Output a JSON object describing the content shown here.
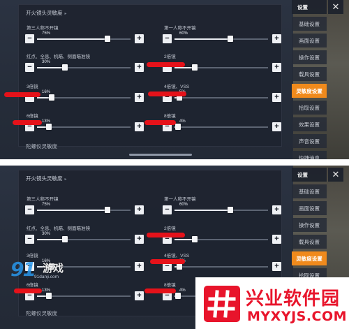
{
  "colors": {
    "accent": "#f08a1c",
    "redaction": "#e5121a",
    "watermark_red": "#e8142b",
    "watermark_blue": "#2896eb"
  },
  "panel": {
    "section_title": "开火镜头灵敏度",
    "section_title_suffix": "▸",
    "next_section": "陀螺仪灵敏度"
  },
  "settings": [
    {
      "label": "第三人称不开镜",
      "value": 75,
      "display": "75%"
    },
    {
      "label": "第一人称不开镜",
      "value": 60,
      "display": "60%"
    },
    {
      "label": "红点、全息、机瞄、侧面瞄准镜",
      "value": 30,
      "display": "30%"
    },
    {
      "label": "2倍镜",
      "value": 22,
      "display": ""
    },
    {
      "label": "3倍镜",
      "value": 16,
      "display": "16%"
    },
    {
      "label": "4倍镜、VSS",
      "value": 5,
      "display": "5%"
    },
    {
      "label": "6倍镜",
      "value": 13,
      "display": "13%"
    },
    {
      "label": "8倍镜",
      "value": 4,
      "display": "4%"
    }
  ],
  "sidebar": {
    "title": "设置",
    "close_icon": "close-icon",
    "items": [
      {
        "label": "基础设置",
        "active": false
      },
      {
        "label": "画面设置",
        "active": false
      },
      {
        "label": "操作设置",
        "active": false
      },
      {
        "label": "载具设置",
        "active": false
      },
      {
        "label": "灵敏度设置",
        "active": true
      },
      {
        "label": "拾取设置",
        "active": false
      },
      {
        "label": "效果设置",
        "active": false
      },
      {
        "label": "声音设置",
        "active": false
      },
      {
        "label": "快捷消息",
        "active": false
      }
    ]
  },
  "watermarks": {
    "site91_big": "91",
    "site91_cn": "游戏",
    "site91_url": "91danji.com",
    "xy_name": "兴业软件园",
    "xy_site": "MYXYJS.COM"
  }
}
